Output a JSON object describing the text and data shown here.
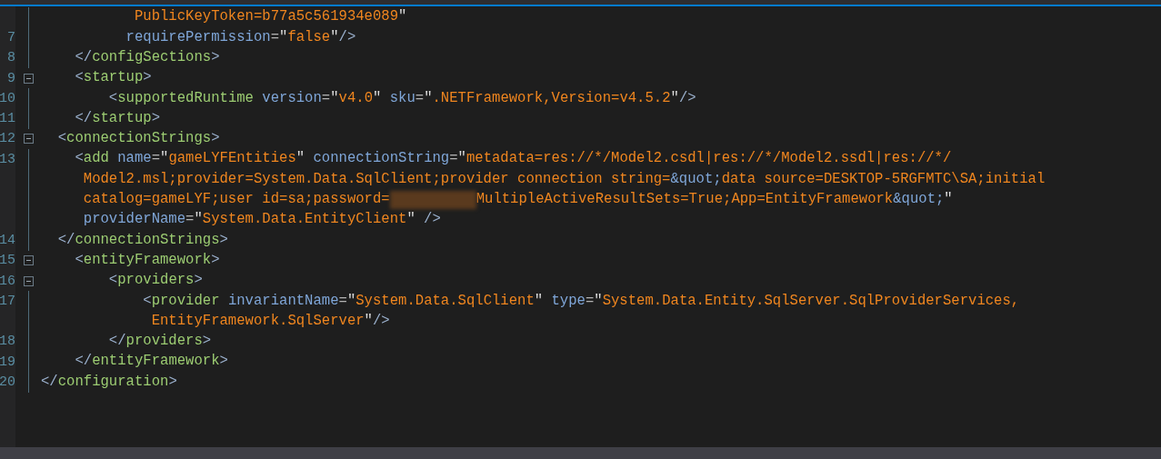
{
  "editor": {
    "lines": [
      {
        "tokens": [
          {
            "kind": "value",
            "text": "           PublicKeyToken=b77a5c561934e089"
          },
          {
            "kind": "quote",
            "text": "\""
          }
        ]
      },
      {
        "number": "7",
        "tokens": [
          {
            "kind": "attr",
            "text": "          requirePermission"
          },
          {
            "kind": "eq",
            "text": "="
          },
          {
            "kind": "quote",
            "text": "\""
          },
          {
            "kind": "value",
            "text": "false"
          },
          {
            "kind": "quote",
            "text": "\""
          },
          {
            "kind": "delim",
            "text": "/>"
          }
        ]
      },
      {
        "number": "8",
        "tokens": [
          {
            "kind": "delim",
            "text": "    </"
          },
          {
            "kind": "tag",
            "text": "configSections"
          },
          {
            "kind": "delim",
            "text": ">"
          }
        ]
      },
      {
        "number": "9",
        "foldable": true,
        "tokens": [
          {
            "kind": "delim",
            "text": "    <"
          },
          {
            "kind": "tag",
            "text": "startup"
          },
          {
            "kind": "delim",
            "text": ">"
          }
        ]
      },
      {
        "number": "10",
        "tokens": [
          {
            "kind": "delim",
            "text": "        <"
          },
          {
            "kind": "tag",
            "text": "supportedRuntime"
          },
          {
            "kind": "attr",
            "text": " version"
          },
          {
            "kind": "eq",
            "text": "="
          },
          {
            "kind": "quote",
            "text": "\""
          },
          {
            "kind": "value",
            "text": "v4.0"
          },
          {
            "kind": "quote",
            "text": "\""
          },
          {
            "kind": "attr",
            "text": " sku"
          },
          {
            "kind": "eq",
            "text": "="
          },
          {
            "kind": "quote",
            "text": "\""
          },
          {
            "kind": "value",
            "text": ".NETFramework,Version=v4.5.2"
          },
          {
            "kind": "quote",
            "text": "\""
          },
          {
            "kind": "delim",
            "text": "/>"
          }
        ]
      },
      {
        "number": "11",
        "tokens": [
          {
            "kind": "delim",
            "text": "    </"
          },
          {
            "kind": "tag",
            "text": "startup"
          },
          {
            "kind": "delim",
            "text": ">"
          }
        ]
      },
      {
        "number": "12",
        "foldable": true,
        "tokens": [
          {
            "kind": "delim",
            "text": "  <"
          },
          {
            "kind": "tag",
            "text": "connectionStrings"
          },
          {
            "kind": "delim",
            "text": ">"
          }
        ]
      },
      {
        "number": "13",
        "tokens": [
          {
            "kind": "delim",
            "text": "    <"
          },
          {
            "kind": "tag",
            "text": "add"
          },
          {
            "kind": "attr",
            "text": " name"
          },
          {
            "kind": "eq",
            "text": "="
          },
          {
            "kind": "quote",
            "text": "\""
          },
          {
            "kind": "value",
            "text": "gameLYFEntities"
          },
          {
            "kind": "quote",
            "text": "\""
          },
          {
            "kind": "attr",
            "text": " connectionString"
          },
          {
            "kind": "eq",
            "text": "="
          },
          {
            "kind": "quote",
            "text": "\""
          },
          {
            "kind": "value",
            "text": "metadata=res://*/Model2.csdl|res://*/Model2.ssdl|res://*/"
          }
        ]
      },
      {
        "tokens": [
          {
            "kind": "value",
            "text": "     Model2.msl;provider=System.Data.SqlClient;provider connection string="
          },
          {
            "kind": "entity",
            "text": "&quot;"
          },
          {
            "kind": "value",
            "text": "data source=DESKTOP-5RGFMTC\\SA;initial"
          }
        ]
      },
      {
        "tokens": [
          {
            "kind": "value",
            "text": "     catalog=gameLYF;user id=sa;password="
          },
          {
            "kind": "redacted"
          },
          {
            "kind": "value",
            "text": "MultipleActiveResultSets=True;App=EntityFramework"
          },
          {
            "kind": "entity",
            "text": "&quot;"
          },
          {
            "kind": "quote",
            "text": "\""
          }
        ]
      },
      {
        "tokens": [
          {
            "kind": "attr",
            "text": "     providerName"
          },
          {
            "kind": "eq",
            "text": "="
          },
          {
            "kind": "quote",
            "text": "\""
          },
          {
            "kind": "value",
            "text": "System.Data.EntityClient"
          },
          {
            "kind": "quote",
            "text": "\""
          },
          {
            "kind": "delim",
            "text": " />"
          }
        ]
      },
      {
        "number": "14",
        "tokens": [
          {
            "kind": "delim",
            "text": "  </"
          },
          {
            "kind": "tag",
            "text": "connectionStrings"
          },
          {
            "kind": "delim",
            "text": ">"
          }
        ]
      },
      {
        "number": "15",
        "foldable": true,
        "tokens": [
          {
            "kind": "delim",
            "text": "    <"
          },
          {
            "kind": "tag",
            "text": "entityFramework"
          },
          {
            "kind": "delim",
            "text": ">"
          }
        ]
      },
      {
        "number": "16",
        "foldable": true,
        "tokens": [
          {
            "kind": "delim",
            "text": "        <"
          },
          {
            "kind": "tag",
            "text": "providers"
          },
          {
            "kind": "delim",
            "text": ">"
          }
        ]
      },
      {
        "number": "17",
        "tokens": [
          {
            "kind": "delim",
            "text": "            <"
          },
          {
            "kind": "tag",
            "text": "provider"
          },
          {
            "kind": "attr",
            "text": " invariantName"
          },
          {
            "kind": "eq",
            "text": "="
          },
          {
            "kind": "quote",
            "text": "\""
          },
          {
            "kind": "value",
            "text": "System.Data.SqlClient"
          },
          {
            "kind": "quote",
            "text": "\""
          },
          {
            "kind": "attr",
            "text": " type"
          },
          {
            "kind": "eq",
            "text": "="
          },
          {
            "kind": "quote",
            "text": "\""
          },
          {
            "kind": "value",
            "text": "System.Data.Entity.SqlServer.SqlProviderServices,"
          }
        ]
      },
      {
        "tokens": [
          {
            "kind": "value",
            "text": "             EntityFramework.SqlServer"
          },
          {
            "kind": "quote",
            "text": "\""
          },
          {
            "kind": "delim",
            "text": "/>"
          }
        ]
      },
      {
        "number": "18",
        "tokens": [
          {
            "kind": "delim",
            "text": "        </"
          },
          {
            "kind": "tag",
            "text": "providers"
          },
          {
            "kind": "delim",
            "text": ">"
          }
        ]
      },
      {
        "number": "19",
        "tokens": [
          {
            "kind": "delim",
            "text": "    </"
          },
          {
            "kind": "tag",
            "text": "entityFramework"
          },
          {
            "kind": "delim",
            "text": ">"
          }
        ]
      },
      {
        "number": "20",
        "tokens": [
          {
            "kind": "delim",
            "text": "</"
          },
          {
            "kind": "tag",
            "text": "configuration"
          },
          {
            "kind": "delim",
            "text": ">"
          }
        ]
      }
    ]
  }
}
